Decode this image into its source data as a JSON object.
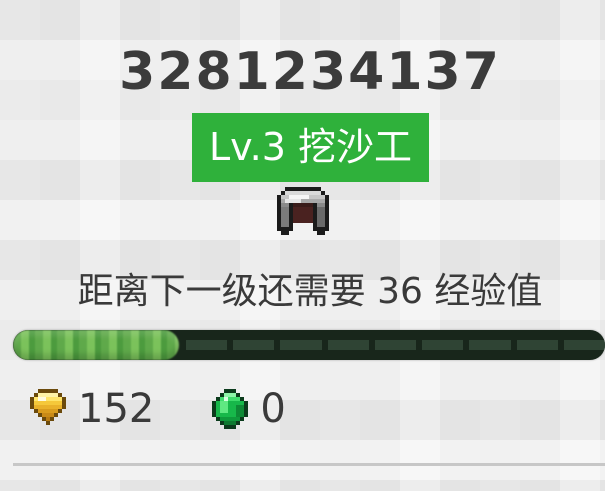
{
  "player": {
    "id": "3281234137",
    "level_label": "Lv.3 挖沙工",
    "badge_color": "#2fb13b",
    "rank_icon": "iron-helmet-icon"
  },
  "progress": {
    "next_level_text": "距离下一级还需要 36 经验值",
    "xp_to_next": 36,
    "fill_fraction": 0.28,
    "fill_color": "#5fb04a",
    "track_color": "#18261b"
  },
  "currency": {
    "gold": {
      "icon": "gold-nugget-icon",
      "value": "152"
    },
    "emerald": {
      "icon": "emerald-icon",
      "value": "0"
    }
  }
}
